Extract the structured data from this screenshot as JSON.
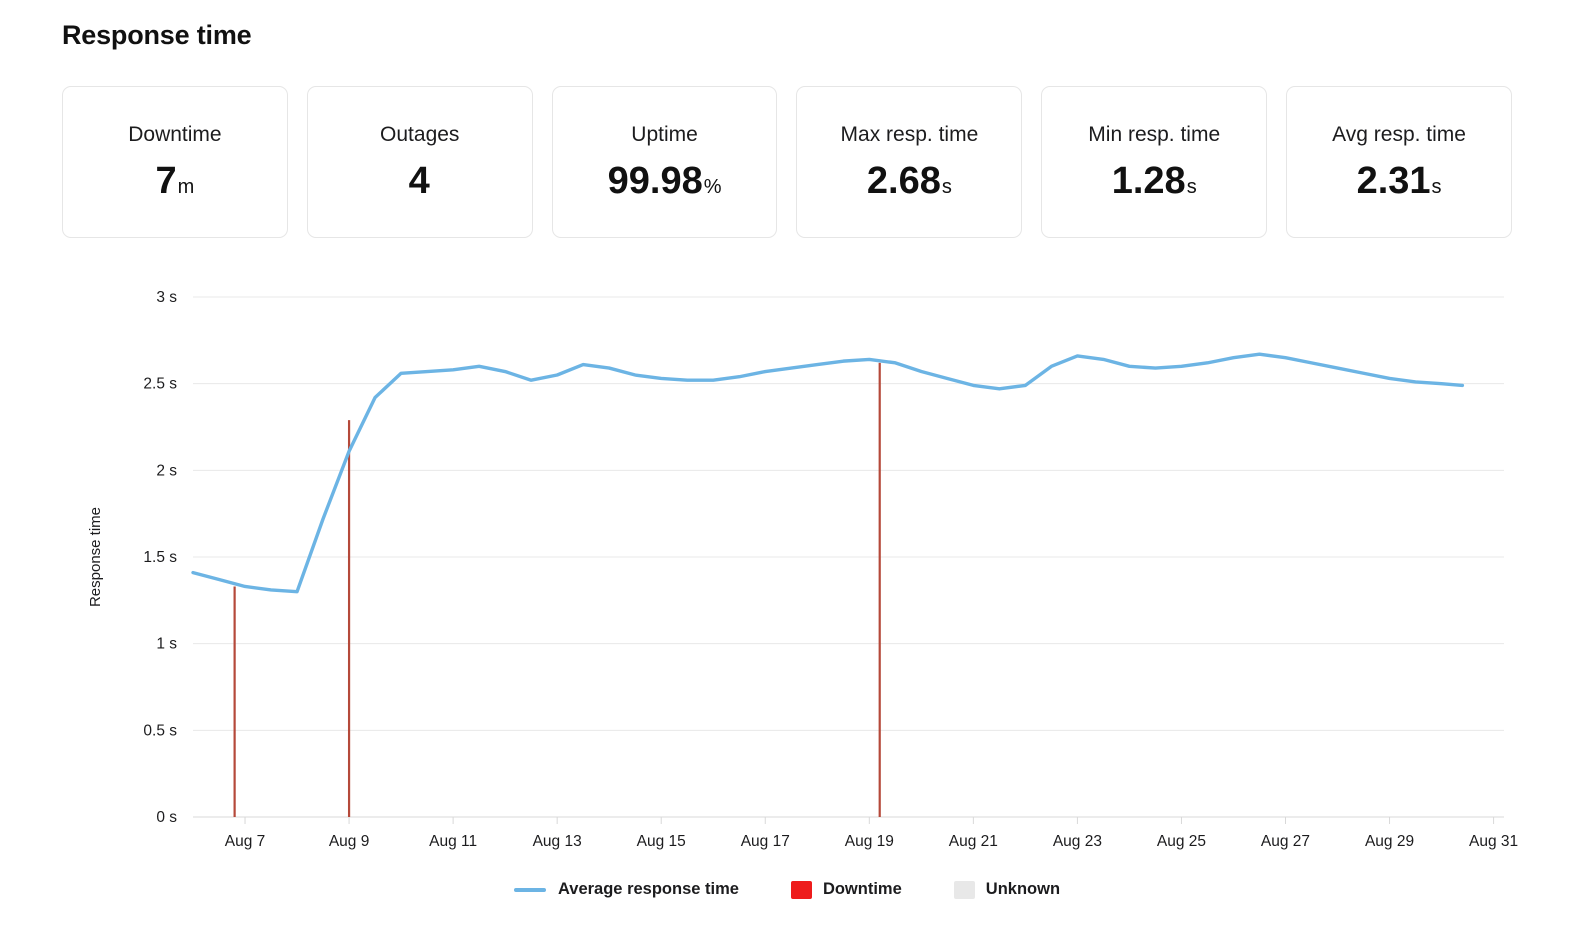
{
  "page_title": "Response time",
  "stats": [
    {
      "label": "Downtime",
      "value": "7",
      "unit": "m"
    },
    {
      "label": "Outages",
      "value": "4",
      "unit": ""
    },
    {
      "label": "Uptime",
      "value": "99.98",
      "unit": "%"
    },
    {
      "label": "Max resp. time",
      "value": "2.68",
      "unit": "s"
    },
    {
      "label": "Min resp. time",
      "value": "1.28",
      "unit": "s"
    },
    {
      "label": "Avg resp. time",
      "value": "2.31",
      "unit": "s"
    }
  ],
  "legend": [
    {
      "label": "Average response time",
      "type": "line",
      "color": "#6CB4E4"
    },
    {
      "label": "Downtime",
      "type": "swatch",
      "color": "#EE1C1C"
    },
    {
      "label": "Unknown",
      "type": "swatch",
      "color": "#E8E8E8"
    }
  ],
  "colors": {
    "series": "#6CB4E4",
    "downtime": "#B5493A",
    "unknown": "#E8E8E8",
    "gridline": "#E8E8E8",
    "card_border": "#E6E6E6"
  },
  "chart_data": {
    "type": "line",
    "title": "",
    "xlabel": "",
    "ylabel": "Response time",
    "ylim": [
      0,
      3
    ],
    "y_ticks": [
      0,
      0.5,
      1,
      1.5,
      2,
      2.5,
      3
    ],
    "y_tick_labels": [
      "0 s",
      "0.5 s",
      "1 s",
      "1.5 s",
      "2 s",
      "2.5 s",
      "3 s"
    ],
    "x_tick_labels": [
      "Aug 7",
      "Aug 9",
      "Aug 11",
      "Aug 13",
      "Aug 15",
      "Aug 17",
      "Aug 19",
      "Aug 21",
      "Aug 23",
      "Aug 25",
      "Aug 27",
      "Aug 29",
      "Aug 31"
    ],
    "x_tick_days": [
      7,
      9,
      11,
      13,
      15,
      17,
      19,
      21,
      23,
      25,
      27,
      29,
      31
    ],
    "xlim_days": [
      6,
      31.2
    ],
    "grid": true,
    "legend_position": "bottom",
    "series": [
      {
        "name": "Average response time",
        "color": "#6CB4E4",
        "x": [
          6.0,
          6.5,
          7.0,
          7.5,
          8.0,
          8.5,
          9.0,
          9.5,
          10.0,
          10.5,
          11.0,
          11.5,
          12.0,
          12.5,
          13.0,
          13.5,
          14.0,
          14.5,
          15.0,
          15.5,
          16.0,
          16.5,
          17.0,
          17.5,
          18.0,
          18.5,
          19.0,
          19.5,
          20.0,
          20.5,
          21.0,
          21.5,
          22.0,
          22.5,
          23.0,
          23.5,
          24.0,
          24.5,
          25.0,
          25.5,
          26.0,
          26.5,
          27.0,
          27.5,
          28.0,
          28.5,
          29.0,
          29.5,
          30.0,
          30.4
        ],
        "y": [
          1.41,
          1.37,
          1.33,
          1.31,
          1.3,
          1.72,
          2.11,
          2.42,
          2.56,
          2.57,
          2.58,
          2.6,
          2.57,
          2.52,
          2.55,
          2.61,
          2.59,
          2.55,
          2.53,
          2.52,
          2.52,
          2.54,
          2.57,
          2.59,
          2.61,
          2.63,
          2.64,
          2.62,
          2.57,
          2.53,
          2.49,
          2.47,
          2.49,
          2.6,
          2.66,
          2.64,
          2.6,
          2.59,
          2.6,
          2.62,
          2.65,
          2.67,
          2.65,
          2.62,
          2.59,
          2.56,
          2.53,
          2.51,
          2.5,
          2.49
        ]
      }
    ],
    "downtime_markers": [
      {
        "x": 6.8,
        "top_value": 1.33,
        "label": "Downtime"
      },
      {
        "x": 9.0,
        "top_value": 2.29,
        "label": "Downtime"
      },
      {
        "x": 19.2,
        "top_value": 2.62,
        "label": "Downtime"
      }
    ]
  }
}
